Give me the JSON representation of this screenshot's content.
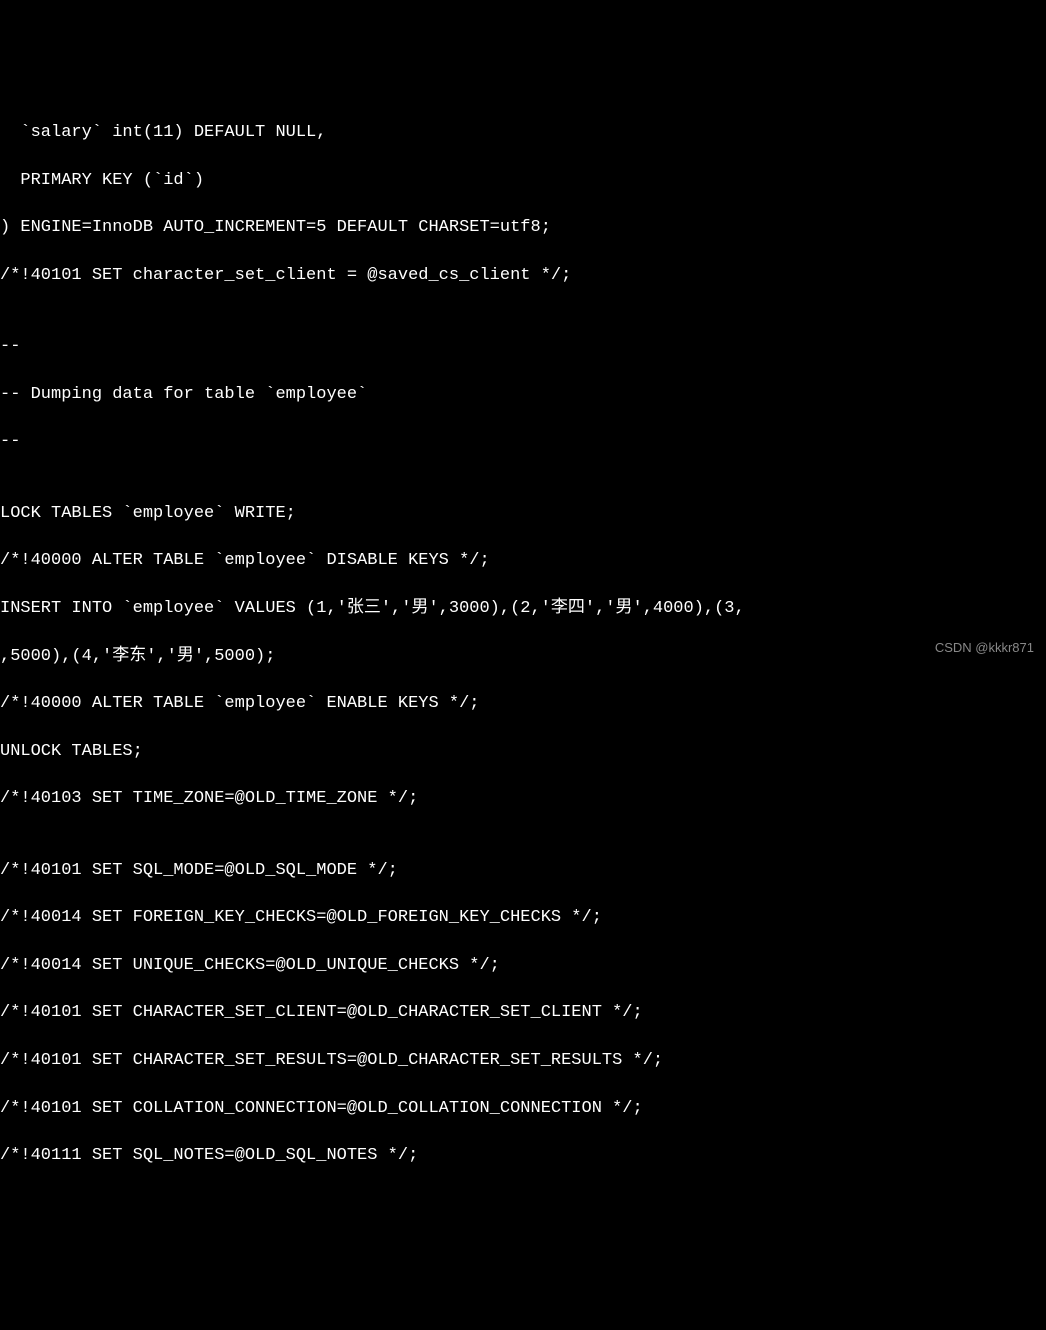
{
  "terminal": {
    "lines": [
      "  `salary` int(11) DEFAULT NULL,",
      "  PRIMARY KEY (`id`)",
      ") ENGINE=InnoDB AUTO_INCREMENT=5 DEFAULT CHARSET=utf8;",
      "/*!40101 SET character_set_client = @saved_cs_client */;",
      "",
      "--",
      "-- Dumping data for table `employee`",
      "--",
      "",
      "LOCK TABLES `employee` WRITE;",
      "/*!40000 ALTER TABLE `employee` DISABLE KEYS */;",
      "INSERT INTO `employee` VALUES (1,'张三','男',3000),(2,'李四','男',4000),(3,",
      ",5000),(4,'李东','男',5000);",
      "/*!40000 ALTER TABLE `employee` ENABLE KEYS */;",
      "UNLOCK TABLES;",
      "/*!40103 SET TIME_ZONE=@OLD_TIME_ZONE */;",
      "",
      "/*!40101 SET SQL_MODE=@OLD_SQL_MODE */;",
      "/*!40014 SET FOREIGN_KEY_CHECKS=@OLD_FOREIGN_KEY_CHECKS */;",
      "/*!40014 SET UNIQUE_CHECKS=@OLD_UNIQUE_CHECKS */;",
      "/*!40101 SET CHARACTER_SET_CLIENT=@OLD_CHARACTER_SET_CLIENT */;",
      "/*!40101 SET CHARACTER_SET_RESULTS=@OLD_CHARACTER_SET_RESULTS */;",
      "/*!40101 SET COLLATION_CONNECTION=@OLD_COLLATION_CONNECTION */;",
      "/*!40111 SET SQL_NOTES=@OLD_SQL_NOTES */;"
    ]
  },
  "watermark": {
    "text": "CSDN @kkkr871"
  }
}
